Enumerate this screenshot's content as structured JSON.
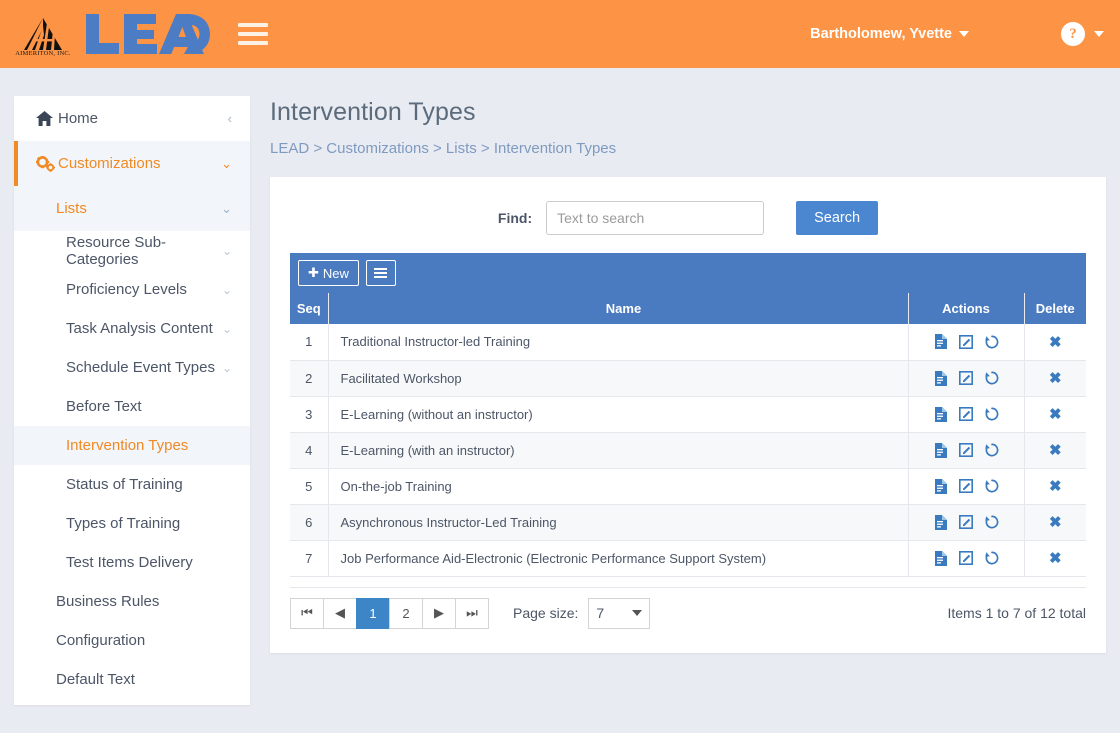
{
  "header": {
    "logo_word": "LEAD",
    "logo_sub": "AIMERITON, INC.",
    "menu_icon": "hamburger-icon",
    "user_name": "Bartholomew, Yvette",
    "help_glyph": "?",
    "orange": "#fd9344"
  },
  "sidebar": {
    "home": {
      "label": "Home",
      "icon": "home-icon",
      "collapse_icon": "‹"
    },
    "customizations": {
      "label": "Customizations",
      "icon": "gears-icon",
      "chevron": "⌄"
    },
    "lists": {
      "label": "Lists",
      "chevron": "⌄"
    },
    "list_items": [
      {
        "label": "Resource Sub-Categories",
        "chevron": "⌄",
        "selected": false
      },
      {
        "label": "Proficiency Levels",
        "chevron": "⌄",
        "selected": false
      },
      {
        "label": "Task Analysis Content",
        "chevron": "⌄",
        "selected": false
      },
      {
        "label": "Schedule Event Types",
        "chevron": "⌄",
        "selected": false
      },
      {
        "label": "Before Text",
        "chevron": "",
        "selected": false
      },
      {
        "label": "Intervention Types",
        "chevron": "",
        "selected": true
      },
      {
        "label": "Status of Training",
        "chevron": "",
        "selected": false
      },
      {
        "label": "Types of Training",
        "chevron": "",
        "selected": false
      },
      {
        "label": "Test Items Delivery",
        "chevron": "",
        "selected": false
      }
    ],
    "bottom_items": [
      {
        "label": "Business Rules"
      },
      {
        "label": "Configuration"
      },
      {
        "label": "Default Text"
      }
    ]
  },
  "page": {
    "title": "Intervention Types",
    "breadcrumb": "LEAD > Customizations > Lists > Intervention Types"
  },
  "search": {
    "find_label": "Find:",
    "placeholder": "Text to search",
    "value": "",
    "button_label": "Search"
  },
  "toolbar": {
    "new_label": "New",
    "new_icon": "plus-icon",
    "menu_icon": "list-menu-icon"
  },
  "table": {
    "columns": [
      "Seq",
      "Name",
      "Actions",
      "Delete"
    ],
    "rows": [
      {
        "seq": "1",
        "name": "Traditional Instructor-led Training"
      },
      {
        "seq": "2",
        "name": "Facilitated Workshop"
      },
      {
        "seq": "3",
        "name": "E-Learning (without an instructor)"
      },
      {
        "seq": "4",
        "name": "E-Learning (with an instructor)"
      },
      {
        "seq": "5",
        "name": "On-the-job Training"
      },
      {
        "seq": "6",
        "name": "Asynchronous Instructor-Led Training"
      },
      {
        "seq": "7",
        "name": "Job Performance Aid-Electronic (Electronic Performance Support System)"
      }
    ],
    "row_action_icons": [
      "document-icon",
      "edit-icon",
      "history-restore-icon"
    ],
    "delete_icon": "close-x-icon"
  },
  "pagination": {
    "first": "⏮",
    "prev": "◀",
    "pages": [
      "1",
      "2"
    ],
    "current_page": "1",
    "next": "▶",
    "last": "⏭",
    "page_size_label": "Page size:",
    "page_size_value": "7",
    "items_total": "Items 1 to 7 of 12 total"
  },
  "colors": {
    "header_orange": "#fd9344",
    "accent_orange": "#f08a24",
    "grid_blue": "#4a7ac0",
    "button_blue": "#4a87d0",
    "page_bg": "#e9ebf2"
  }
}
